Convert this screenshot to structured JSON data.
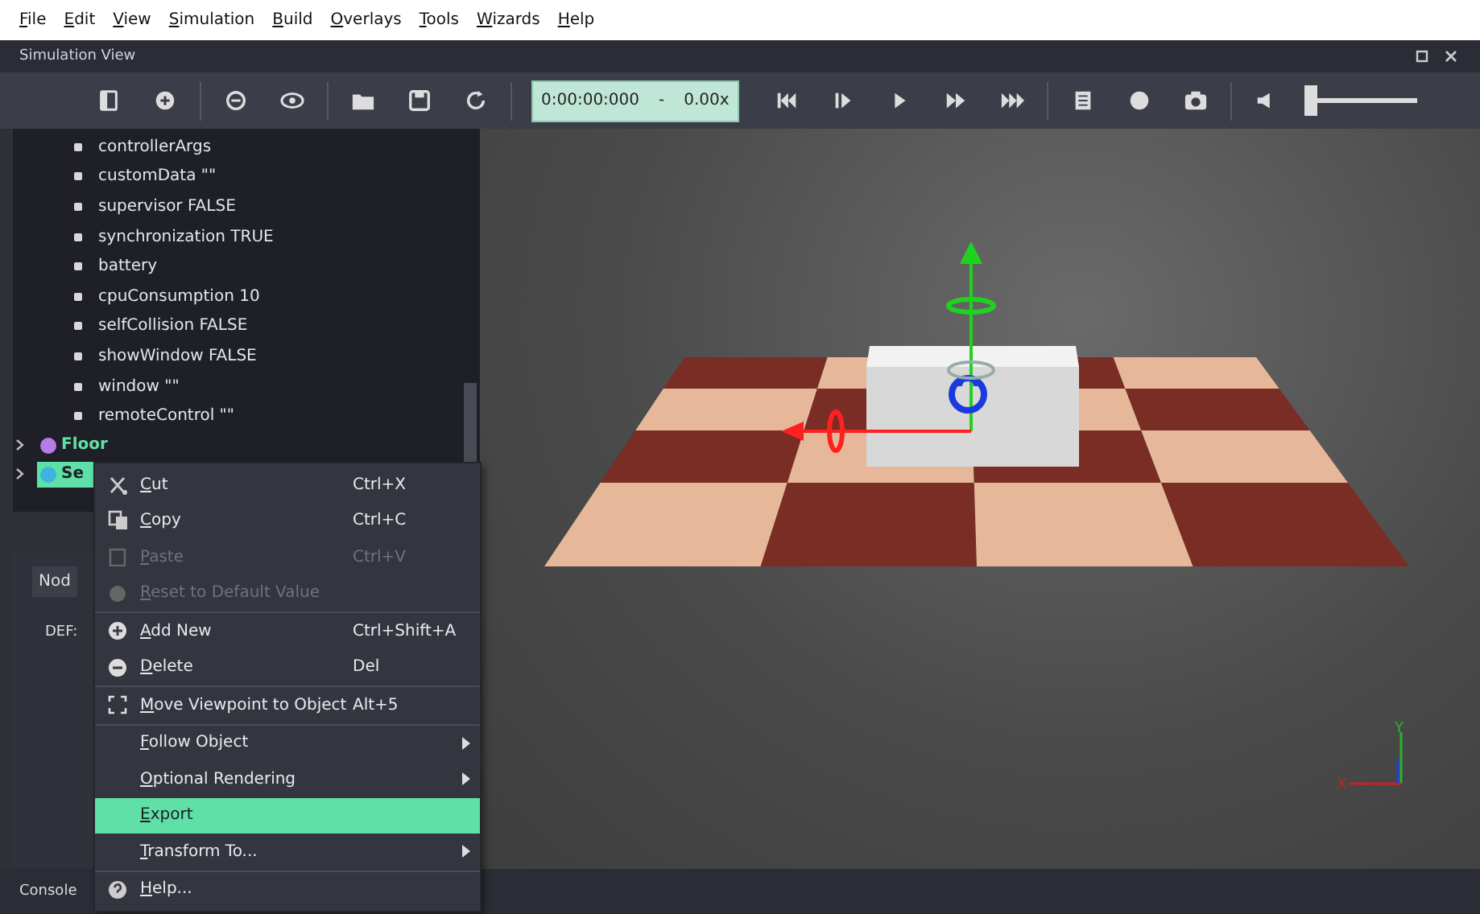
{
  "menubar": [
    "File",
    "Edit",
    "View",
    "Simulation",
    "Build",
    "Overlays",
    "Tools",
    "Wizards",
    "Help"
  ],
  "panel": {
    "title": "Simulation View"
  },
  "toolbar": {
    "time": "0:00:00:000",
    "separator": "-",
    "speed": "0.00x",
    "volume": {
      "level": 0.0
    }
  },
  "tree": [
    {
      "kind": "field",
      "label": "controllerArgs"
    },
    {
      "kind": "field",
      "label": "customData \"\""
    },
    {
      "kind": "field",
      "label": "supervisor FALSE"
    },
    {
      "kind": "field",
      "label": "synchronization TRUE"
    },
    {
      "kind": "field",
      "label": "battery"
    },
    {
      "kind": "field",
      "label": "cpuConsumption 10"
    },
    {
      "kind": "field",
      "label": "selfCollision FALSE"
    },
    {
      "kind": "field",
      "label": "showWindow FALSE"
    },
    {
      "kind": "field",
      "label": "window \"\""
    },
    {
      "kind": "field",
      "label": "remoteControl \"\""
    },
    {
      "kind": "node",
      "label": "Floor",
      "color": "#b57de8",
      "selected": false
    },
    {
      "kind": "node",
      "label": "Se",
      "color": "#3fb4e0",
      "selected": true
    }
  ],
  "node_panel": {
    "tab": "Nod",
    "def_label": "DEF:"
  },
  "context_menu": [
    {
      "kind": "item",
      "label": "Cut",
      "shortcut": "Ctrl+X",
      "disabled": false,
      "selected": false,
      "submenu": false
    },
    {
      "kind": "item",
      "label": "Copy",
      "shortcut": "Ctrl+C",
      "disabled": false,
      "selected": false,
      "submenu": false
    },
    {
      "kind": "item",
      "label": "Paste",
      "shortcut": "Ctrl+V",
      "disabled": true,
      "selected": false,
      "submenu": false
    },
    {
      "kind": "item",
      "label": "Reset to Default Value",
      "disabled": true,
      "selected": false,
      "submenu": false
    },
    {
      "kind": "separator"
    },
    {
      "kind": "item",
      "label": "Add New",
      "shortcut": "Ctrl+Shift+A",
      "disabled": false,
      "selected": false,
      "submenu": false
    },
    {
      "kind": "item",
      "label": "Delete",
      "shortcut": "Del",
      "disabled": false,
      "selected": false,
      "submenu": false
    },
    {
      "kind": "separator"
    },
    {
      "kind": "item",
      "label": "Move Viewpoint to Object",
      "shortcut": "Alt+5",
      "disabled": false,
      "selected": false,
      "submenu": false
    },
    {
      "kind": "separator"
    },
    {
      "kind": "item",
      "label": "Follow Object",
      "disabled": false,
      "selected": false,
      "submenu": true
    },
    {
      "kind": "item",
      "label": "Optional Rendering",
      "disabled": false,
      "selected": false,
      "submenu": true
    },
    {
      "kind": "item",
      "label": "Export",
      "disabled": false,
      "selected": true,
      "submenu": false
    },
    {
      "kind": "item",
      "label": "Transform To...",
      "disabled": false,
      "selected": false,
      "submenu": true
    },
    {
      "kind": "separator"
    },
    {
      "kind": "item",
      "label": "Help...",
      "disabled": false,
      "selected": false,
      "submenu": false
    }
  ],
  "viewport": {
    "axis_labels": [
      "Y",
      "X"
    ]
  },
  "console": {
    "tab": "Console"
  }
}
